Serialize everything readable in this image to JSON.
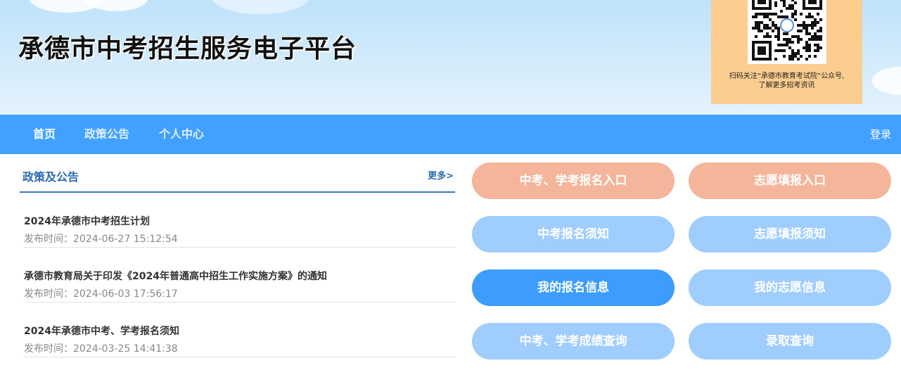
{
  "banner": {
    "title": "承德市中考招生服务电子平台",
    "qr_caption_line1": "扫码关注“承德市教育考试院”公众号,",
    "qr_caption_line2": "了解更多招考资讯"
  },
  "nav": {
    "items": [
      {
        "label": "首页",
        "active": true
      },
      {
        "label": "政策公告",
        "active": false
      },
      {
        "label": "个人中心",
        "active": false
      }
    ],
    "login": "登录"
  },
  "news": {
    "title": "政策及公告",
    "more": "更多>",
    "items": [
      {
        "title": "2024年承德市中考招生计划",
        "date": "发布时间：2024-06-27 15:12:54"
      },
      {
        "title": "承德市教育局关于印发《2024年普通高中招生工作实施方案》的通知",
        "date": "发布时间：2024-06-03 17:56:17"
      },
      {
        "title": "2024年承德市中考、学考报名须知",
        "date": "发布时间：2024-03-25 14:41:38"
      }
    ]
  },
  "actions": [
    {
      "label": "中考、学考报名入口",
      "style": "salmon"
    },
    {
      "label": "志愿填报入口",
      "style": "salmon"
    },
    {
      "label": "中考报名须知",
      "style": "light"
    },
    {
      "label": "志愿填报须知",
      "style": "light"
    },
    {
      "label": "我的报名信息",
      "style": "strong"
    },
    {
      "label": "我的志愿信息",
      "style": "light"
    },
    {
      "label": "中考、学考成绩查询",
      "style": "light"
    },
    {
      "label": "录取查询",
      "style": "light"
    }
  ],
  "colors": {
    "nav_bg": "#42a1ff",
    "salmon_button": "#f4b59a",
    "light_button": "#9fcdfd",
    "strong_button": "#3c9dfd",
    "qr_panel": "#fbcd8f",
    "link_blue": "#2b6cb0"
  }
}
